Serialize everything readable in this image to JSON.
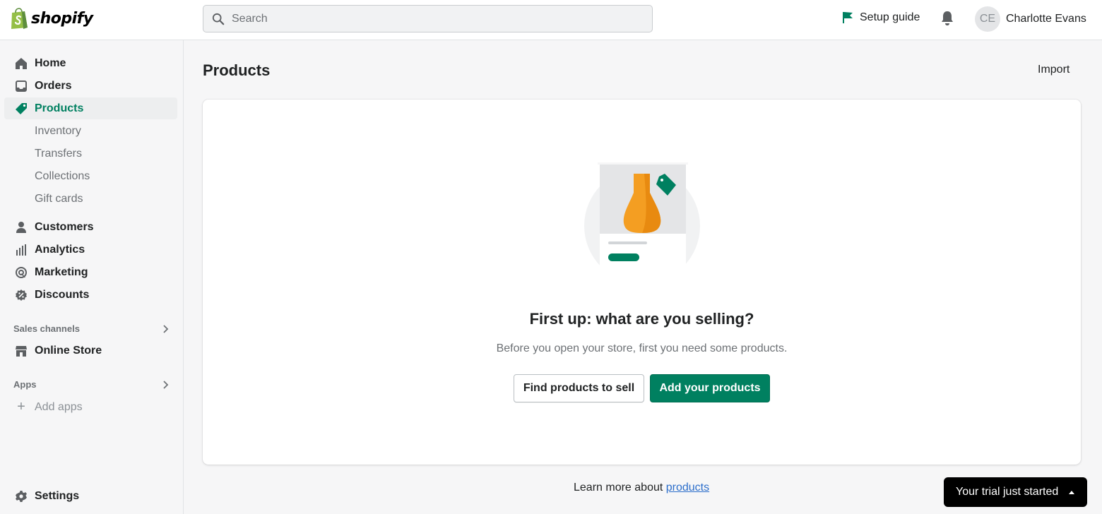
{
  "brand": {
    "name": "shopify",
    "color": "#95bf47",
    "accent": "#008060"
  },
  "topbar": {
    "search_placeholder": "Search",
    "setup_guide_label": "Setup guide",
    "user": {
      "initials": "CE",
      "name": "Charlotte Evans"
    }
  },
  "sidebar": {
    "items": [
      {
        "label": "Home",
        "icon": "home-icon"
      },
      {
        "label": "Orders",
        "icon": "inbox-icon"
      },
      {
        "label": "Products",
        "icon": "tag-icon",
        "active": true
      },
      {
        "label": "Customers",
        "icon": "person-icon"
      },
      {
        "label": "Analytics",
        "icon": "bar-chart-icon"
      },
      {
        "label": "Marketing",
        "icon": "target-icon"
      },
      {
        "label": "Discounts",
        "icon": "discount-icon"
      }
    ],
    "product_subitems": [
      "Inventory",
      "Transfers",
      "Collections",
      "Gift cards"
    ],
    "sales_channels": {
      "heading": "Sales channels",
      "items": [
        {
          "label": "Online Store",
          "icon": "store-icon"
        }
      ]
    },
    "apps": {
      "heading": "Apps",
      "add_label": "Add apps"
    },
    "settings_label": "Settings"
  },
  "main": {
    "title": "Products",
    "import_label": "Import",
    "empty_state": {
      "heading": "First up: what are you selling?",
      "description": "Before you open your store, first you need some products.",
      "secondary_action": "Find products to sell",
      "primary_action": "Add your products"
    },
    "footer": {
      "prefix": "Learn more about ",
      "link": "products"
    }
  },
  "trial_banner": {
    "label": "Your trial just started"
  }
}
